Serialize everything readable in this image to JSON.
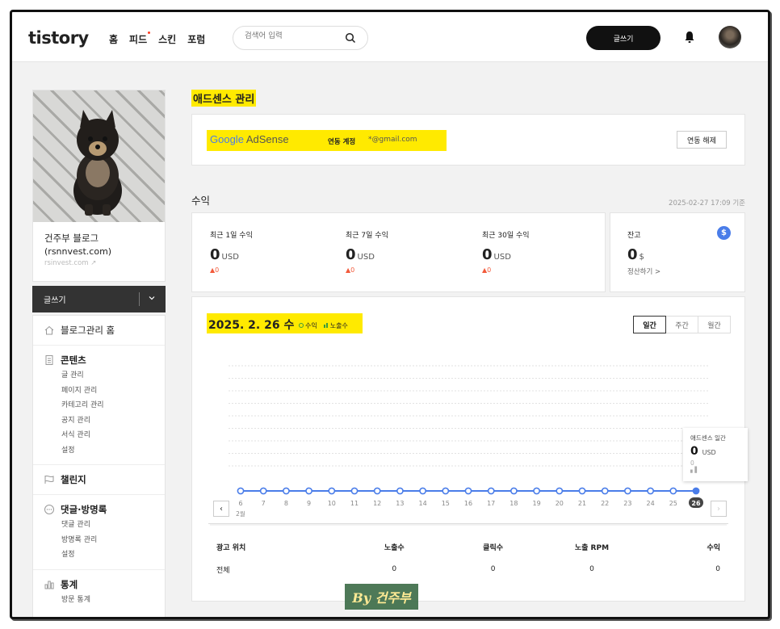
{
  "header": {
    "logo": "tistory",
    "nav": [
      "홈",
      "피드",
      "스킨",
      "포럼"
    ],
    "search_placeholder": "검색어 입력",
    "write_button": "글쓰기"
  },
  "sidebar": {
    "blog_name": "건주부 블로그",
    "blog_domain": "(rsnnvest.com)",
    "blog_url": "rsinvest.com",
    "write_button": "글쓰기",
    "sections": [
      {
        "title": "블로그관리 홈",
        "icon": "home-icon",
        "items": []
      },
      {
        "title": "콘텐츠",
        "icon": "document-icon",
        "items": [
          "글 관리",
          "페이지 관리",
          "카테고리 관리",
          "공지 관리",
          "서식 관리",
          "설정"
        ]
      },
      {
        "title": "챌린지",
        "icon": "flag-icon",
        "items": []
      },
      {
        "title": "댓글·방명록",
        "icon": "chat-icon",
        "items": [
          "댓글 관리",
          "방명록 관리",
          "설정"
        ]
      },
      {
        "title": "통계",
        "icon": "stats-icon",
        "items": [
          "방문 통계"
        ]
      }
    ]
  },
  "adsense": {
    "section_title": "애드센스 관리",
    "logo_google": "Google",
    "logo_adsense": "AdSense",
    "linked_label": "연동 계정",
    "email": "*@gmail.com",
    "unlink_button": "연동 해제"
  },
  "revenue": {
    "title": "수익",
    "updated": "2025-02-27 17:09 기준",
    "items": [
      {
        "label": "최근 1일 수익",
        "value": "0",
        "unit": "USD",
        "change": "0"
      },
      {
        "label": "최근 7일 수익",
        "value": "0",
        "unit": "USD",
        "change": "0"
      },
      {
        "label": "최근 30일 수익",
        "value": "0",
        "unit": "USD",
        "change": "0"
      }
    ],
    "balance": {
      "label": "잔고",
      "value": "0",
      "unit": "$",
      "settle": "정산하기 >",
      "icon": "dollar-icon"
    }
  },
  "chart_panel": {
    "date": "2025. 2. 26 수",
    "legend": [
      "수익",
      "노출수"
    ],
    "tabs": [
      "일간",
      "주간",
      "월간"
    ],
    "active_tab": "일간",
    "tooltip": {
      "title": "애드센스 일간",
      "value": "0",
      "unit": "USD",
      "sub": "0"
    },
    "month_label": "2월",
    "table": {
      "headers": [
        "광고 위치",
        "노출수",
        "클릭수",
        "노출 RPM",
        "수익"
      ],
      "rows": [
        [
          "전체",
          "0",
          "0",
          "0",
          "0"
        ]
      ]
    }
  },
  "chart_data": {
    "type": "line",
    "x": [
      "6",
      "7",
      "8",
      "9",
      "10",
      "11",
      "12",
      "13",
      "14",
      "15",
      "16",
      "17",
      "18",
      "19",
      "20",
      "21",
      "22",
      "23",
      "24",
      "25",
      "26"
    ],
    "series": [
      {
        "name": "수익",
        "values": [
          0,
          0,
          0,
          0,
          0,
          0,
          0,
          0,
          0,
          0,
          0,
          0,
          0,
          0,
          0,
          0,
          0,
          0,
          0,
          0,
          0
        ],
        "color": "#4a7de9"
      }
    ],
    "highlight_x": "26",
    "grid": true
  },
  "watermark": "By 건주부",
  "colors": {
    "accent": "#4a7de9",
    "highlight": "#ffea00",
    "increase": "#f25a3b"
  }
}
